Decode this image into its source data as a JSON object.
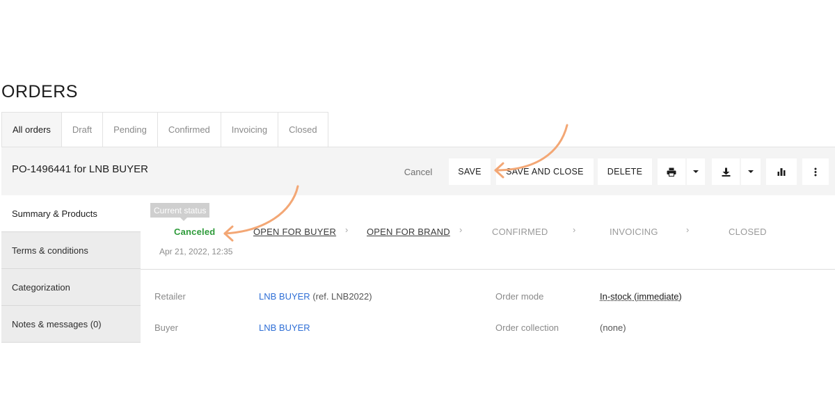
{
  "page": {
    "title": "ORDERS"
  },
  "tabs": [
    {
      "label": "All orders",
      "active": true
    },
    {
      "label": "Draft"
    },
    {
      "label": "Pending"
    },
    {
      "label": "Confirmed"
    },
    {
      "label": "Invoicing"
    },
    {
      "label": "Closed"
    }
  ],
  "order": {
    "title": "PO-1496441 for LNB BUYER",
    "actions": {
      "cancel": "Cancel",
      "save": "SAVE",
      "save_close": "SAVE AND CLOSE",
      "delete": "DELETE"
    },
    "icons": [
      "printer-icon",
      "download-icon",
      "bar-chart-icon",
      "more-vertical-icon"
    ]
  },
  "sidebar": {
    "items": [
      {
        "label": "Summary & Products",
        "active": true
      },
      {
        "label": "Terms & conditions"
      },
      {
        "label": "Categorization"
      },
      {
        "label": "Notes & messages (0)"
      }
    ]
  },
  "status": {
    "tooltip": "Current status",
    "current": "Canceled",
    "date": "Apr 21, 2022, 12:35",
    "steps": [
      "OPEN FOR BUYER",
      "OPEN FOR BRAND",
      "CONFIRMED",
      "INVOICING",
      "CLOSED"
    ],
    "current_color": "#2e9b3a"
  },
  "details": {
    "retailer_label": "Retailer",
    "retailer_name": "LNB BUYER",
    "retailer_ref": " (ref. LNB2022)",
    "buyer_label": "Buyer",
    "buyer_name": "LNB BUYER",
    "order_mode_label": "Order mode",
    "order_mode_value": "In-stock (immediate)",
    "order_collection_label": "Order collection",
    "order_collection_value": "(none)"
  },
  "colors": {
    "link": "#2f6fd6",
    "annotation_arrow": "#f3a775"
  }
}
